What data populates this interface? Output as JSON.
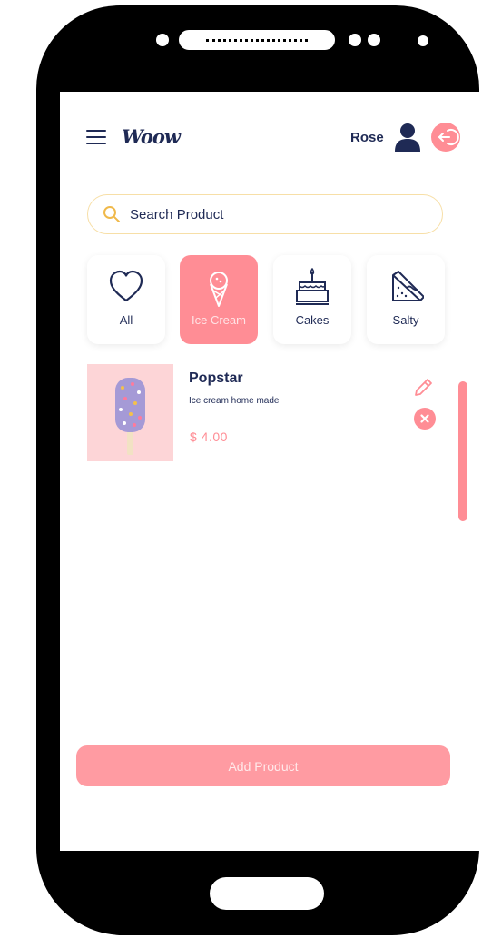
{
  "header": {
    "logo": "Woow",
    "username": "Rose"
  },
  "search": {
    "placeholder": "Search Product"
  },
  "categories": [
    {
      "label": "All",
      "icon": "heart-icon",
      "active": false
    },
    {
      "label": "Ice Cream",
      "icon": "ice-cream-icon",
      "active": true
    },
    {
      "label": "Cakes",
      "icon": "cake-icon",
      "active": false
    },
    {
      "label": "Salty",
      "icon": "sandwich-icon",
      "active": false
    }
  ],
  "products": [
    {
      "name": "Popstar",
      "description": "Ice cream home made",
      "price": "$ 4.00"
    }
  ],
  "actions": {
    "add_product": "Add Product"
  },
  "colors": {
    "accent": "#ff8d95",
    "text": "#1f2a55",
    "search_border": "#f7dfa7"
  }
}
